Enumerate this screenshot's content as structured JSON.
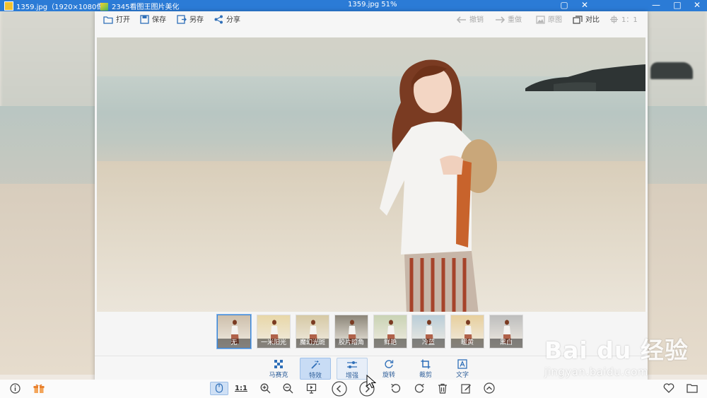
{
  "outer_window": {
    "tab_title": "1359.jpg（1920×1080像",
    "app_title": "2345看图王图片美化",
    "center_title": "1359.jpg  51%",
    "controls": {
      "minimize": "—",
      "maximize": "□",
      "close": "✕"
    }
  },
  "toolbar": {
    "open": "打开",
    "save": "保存",
    "save_as": "另存",
    "share": "分享",
    "undo": "撤销",
    "redo": "重做",
    "original": "原图",
    "compare": "对比",
    "ratio": "1：1"
  },
  "filters": [
    {
      "label": "无",
      "active": true
    },
    {
      "label": "一米阳光",
      "active": false
    },
    {
      "label": "魔幻光斑",
      "active": false
    },
    {
      "label": "胶片暗角",
      "active": false
    },
    {
      "label": "鲜艳",
      "active": false
    },
    {
      "label": "冷蓝",
      "active": false
    },
    {
      "label": "暖黄",
      "active": false
    },
    {
      "label": "黑白",
      "active": false
    }
  ],
  "edit_tools": [
    {
      "label": "马赛克",
      "icon": "mosaic-icon",
      "state": "normal"
    },
    {
      "label": "特效",
      "icon": "magic-wand-icon",
      "state": "active"
    },
    {
      "label": "增强",
      "icon": "sliders-icon",
      "state": "hover"
    },
    {
      "label": "旋转",
      "icon": "rotate-icon",
      "state": "normal"
    },
    {
      "label": "裁剪",
      "icon": "crop-icon",
      "state": "normal"
    },
    {
      "label": "文字",
      "icon": "text-icon",
      "state": "normal"
    }
  ],
  "bottom_bar": {
    "actual_size": "1:1"
  },
  "watermark": {
    "brand": "Bai du 经验",
    "url": "jingyan.baidu.com"
  },
  "colors": {
    "title_bar": "#2b7bd6",
    "accent": "#3a86d8",
    "tool_text": "#2f5f9a"
  }
}
